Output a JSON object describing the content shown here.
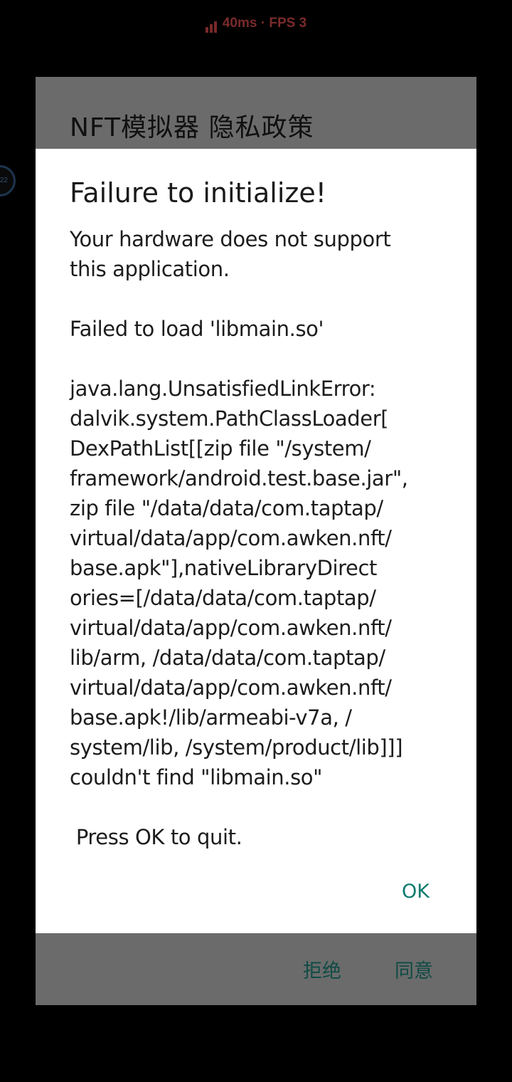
{
  "status_overlay": {
    "ping": "40ms",
    "separator": "·",
    "fps": "FPS 3"
  },
  "floating_ball": {
    "label": "22"
  },
  "background_dialog": {
    "title": "NFT模拟器 隐私政策",
    "reject_label": "拒绝",
    "agree_label": "同意"
  },
  "error_dialog": {
    "title": "Failure to initialize!",
    "message_lines": [
      "Your hardware does not support",
      "this application.",
      "",
      "Failed to load 'libmain.so'",
      "",
      "java.lang.UnsatisfiedLinkError:",
      "dalvik.system.PathClassLoader[",
      "DexPathList[[zip file \"/system/",
      "framework/android.test.base.jar\",",
      "zip file \"/data/data/com.taptap/",
      "virtual/data/app/com.awken.nft/",
      "base.apk\"],nativeLibraryDirect",
      "ories=[/data/data/com.taptap/",
      "virtual/data/app/com.awken.nft/",
      "lib/arm, /data/data/com.taptap/",
      "virtual/data/app/com.awken.nft/",
      "base.apk!/lib/armeabi-v7a, /",
      "system/lib, /system/product/lib]]]",
      "couldn't find \"libmain.so\"",
      "",
      " Press OK to quit."
    ],
    "ok_label": "OK"
  },
  "colors": {
    "accent": "#0b7a6e",
    "scrim": "#6b6b6b",
    "overlay_text": "#7a2a2a"
  }
}
